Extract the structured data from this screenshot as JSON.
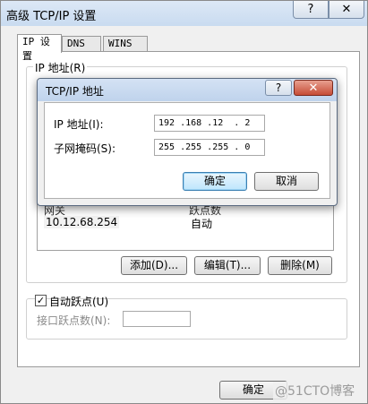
{
  "window": {
    "title": "高级 TCP/IP 设置",
    "help_glyph": "?",
    "close_glyph": "✕"
  },
  "tabs": [
    {
      "label": "IP 设置",
      "active": true
    },
    {
      "label": "DNS",
      "active": false
    },
    {
      "label": "WINS",
      "active": false
    }
  ],
  "ip_section": {
    "label": "IP 地址(R)"
  },
  "gateway_section": {
    "header_gateway": "网关",
    "header_metric": "跃点数",
    "rows": [
      {
        "gateway": "10.12.68.254",
        "metric": "自动"
      }
    ],
    "add_button": "添加(D)...",
    "edit_button": "编辑(T)...",
    "delete_button": "删除(M)"
  },
  "auto_metric": {
    "checked": true,
    "check_glyph": "✓",
    "label": "自动跃点(U)",
    "interface_metric_label": "接口跃点数(N):",
    "interface_metric_value": ""
  },
  "bottom": {
    "ok_button": "确定",
    "watermark": "@51CTO博客"
  },
  "dialog": {
    "title": "TCP/IP 地址",
    "help_glyph": "?",
    "close_glyph": "✕",
    "ip_label": "IP 地址(I):",
    "ip_value": "192 .168 .12  . 2",
    "mask_label": "子网掩码(S):",
    "mask_value": "255 .255 .255 . 0",
    "ok_button": "确定",
    "cancel_button": "取消"
  },
  "colors": {
    "window_bg": "#f0f0f0",
    "title_gradient_top": "#dce8f6",
    "dialog_close": "#c64c36",
    "default_button_border": "#3c7fb1"
  }
}
